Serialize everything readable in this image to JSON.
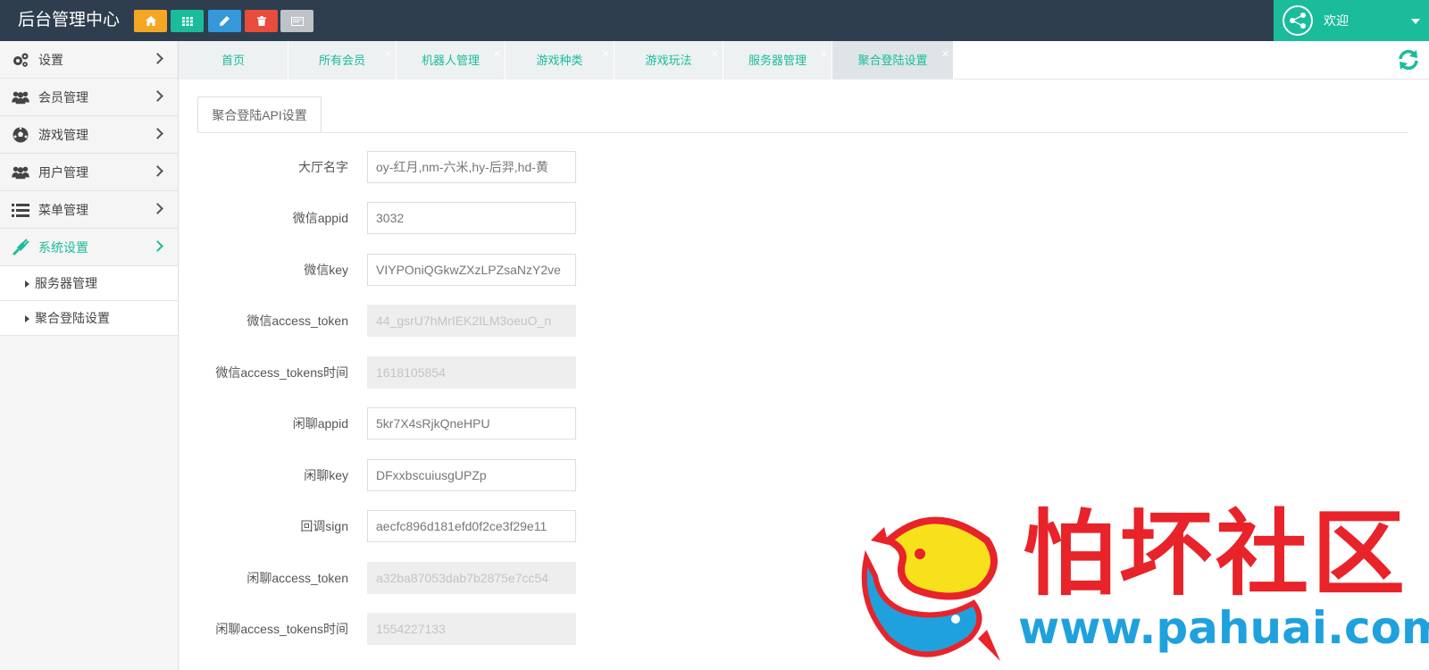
{
  "header": {
    "brand": "后台管理中心",
    "quick_buttons": [
      {
        "name": "home",
        "icon": "home-icon",
        "color": "#f5a623"
      },
      {
        "name": "grid",
        "icon": "grid-icon",
        "color": "#1abc9c"
      },
      {
        "name": "edit",
        "icon": "pencil-icon",
        "color": "#3498db"
      },
      {
        "name": "trash",
        "icon": "trash-icon",
        "color": "#e74c3c"
      },
      {
        "name": "card",
        "icon": "card-icon",
        "color": "#bdc3c7"
      }
    ],
    "welcome": "欢迎",
    "accent": "#1abc9c"
  },
  "sidebar": {
    "items": [
      {
        "label": "设置",
        "icon": "gears-icon"
      },
      {
        "label": "会员管理",
        "icon": "users-icon"
      },
      {
        "label": "游戏管理",
        "icon": "soccer-ball-icon"
      },
      {
        "label": "用户管理",
        "icon": "users-icon"
      },
      {
        "label": "菜单管理",
        "icon": "list-icon"
      },
      {
        "label": "系统设置",
        "icon": "plug-icon",
        "active": true
      }
    ],
    "subitems": [
      {
        "label": "服务器管理"
      },
      {
        "label": "聚合登陆设置"
      }
    ]
  },
  "tabs": [
    {
      "label": "首页"
    },
    {
      "label": "所有会员"
    },
    {
      "label": "机器人管理"
    },
    {
      "label": "游戏种类"
    },
    {
      "label": "游戏玩法"
    },
    {
      "label": "服务器管理"
    },
    {
      "label": "聚合登陆设置",
      "active": true
    }
  ],
  "content": {
    "tab_label": "聚合登陆API设置",
    "fields": [
      {
        "label": "大厅名字",
        "value": "oy-红月,nm-六米,hy-后羿,hd-黄",
        "readonly": false
      },
      {
        "label": "微信appid",
        "value": "3032",
        "readonly": false
      },
      {
        "label": "微信key",
        "value": "VIYPOniQGkwZXzLPZsaNzY2ve",
        "readonly": false
      },
      {
        "label": "微信access_token",
        "value": "44_gsrU7hMrIEK2ILM3oeuO_n",
        "readonly": true
      },
      {
        "label": "微信access_tokens时间",
        "value": "1618105854",
        "readonly": true
      },
      {
        "label": "闲聊appid",
        "value": "5kr7X4sRjkQneHPU",
        "readonly": false
      },
      {
        "label": "闲聊key",
        "value": "DFxxbscuiusgUPZp",
        "readonly": false
      },
      {
        "label": "回调sign",
        "value": "aecfc896d181efd0f2ce3f29e11",
        "readonly": false
      },
      {
        "label": "闲聊access_token",
        "value": "a32ba87053dab7b2875e7cc54",
        "readonly": true
      },
      {
        "label": "闲聊access_tokens时间",
        "value": "1554227133",
        "readonly": true
      }
    ]
  },
  "watermark": {
    "title": "怕坏社区",
    "url": "www.pahuai.com"
  }
}
